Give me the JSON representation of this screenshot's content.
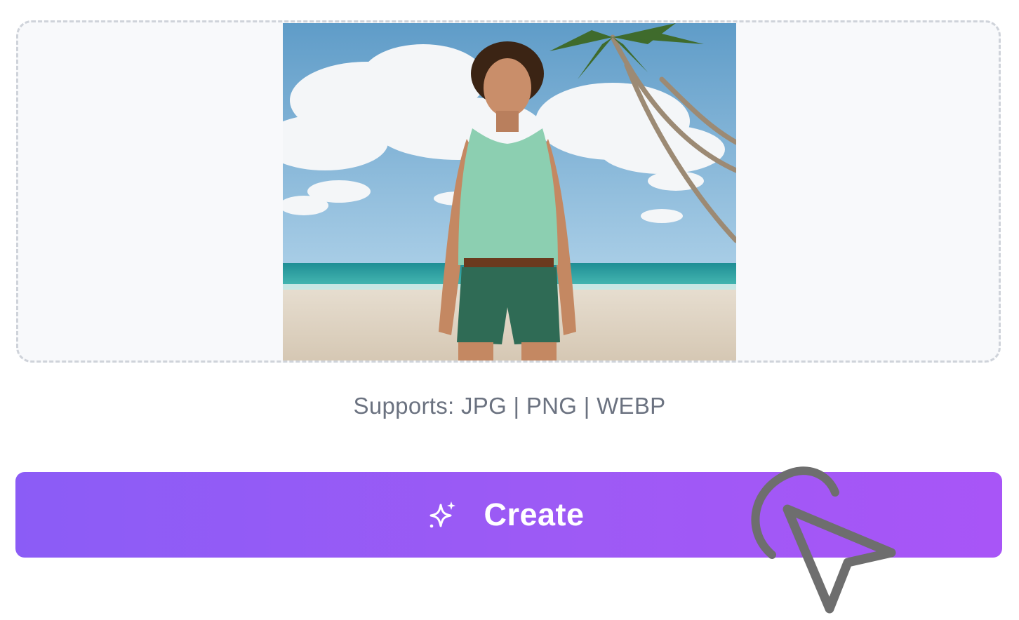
{
  "upload": {
    "preview_alt": "Man in mint tank top and green shorts on a beach",
    "supports_text": "Supports: JPG | PNG | WEBP"
  },
  "actions": {
    "create_label": "Create",
    "create_icon": "sparkle-icon"
  },
  "colors": {
    "accent_start": "#8b5cf6",
    "accent_end": "#a855f7",
    "dropzone_border": "#cfd3da",
    "muted_text": "#6b7280"
  }
}
